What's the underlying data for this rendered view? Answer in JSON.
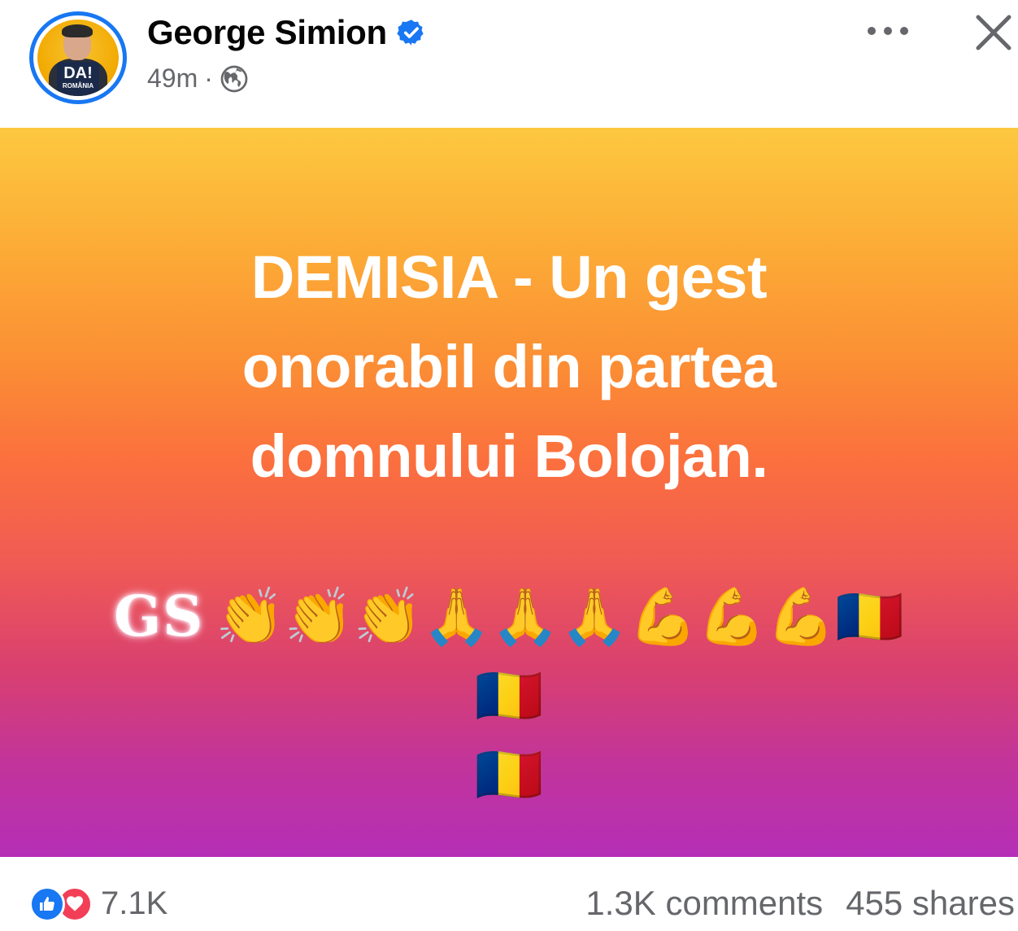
{
  "post": {
    "author_name": "George Simion",
    "time_ago": "49m",
    "separator": "·",
    "avatar_badge_text": "DA!",
    "avatar_badge_subtext": "ROMÂNIA",
    "text_lines": [
      "DEMISIA - Un gest",
      "onorabil din partea",
      "domnului Bolojan."
    ],
    "signature": "GS",
    "emoji_line_1": "👏👏👏🙏🙏🙏💪💪💪🇷🇴🇷🇴",
    "emoji_line_2": "🇷🇴",
    "background_colors": [
      "#fdc840",
      "#fb8f34",
      "#f05a55",
      "#c2349a",
      "#b52fb7"
    ]
  },
  "stats": {
    "reaction_count": "7.1K",
    "comments": "1.3K comments",
    "shares": "455 shares"
  },
  "icons": {
    "verified": "verified-badge-icon",
    "audience": "globe-icon",
    "more": "more-options-icon",
    "close": "close-icon",
    "like": "like-reaction-icon",
    "love": "love-reaction-icon"
  },
  "colors": {
    "accent": "#1877f2",
    "secondary_text": "#65676b",
    "love": "#f33e58"
  }
}
